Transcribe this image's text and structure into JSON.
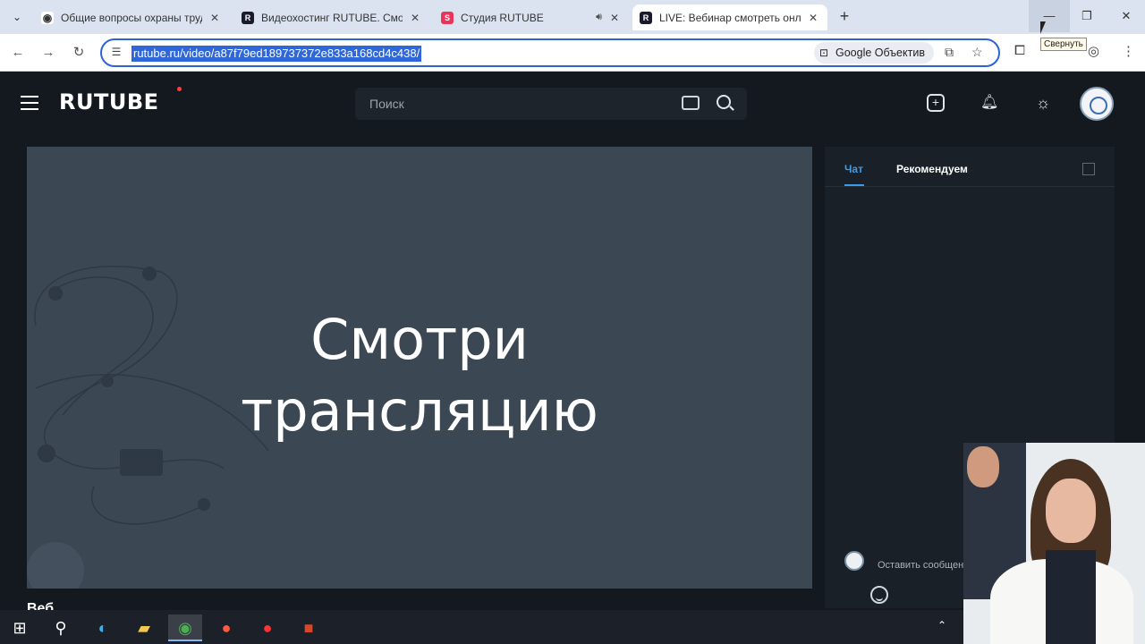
{
  "browser": {
    "tabs": [
      {
        "title": "Общие вопросы охраны труда",
        "favicon": "eye-icon",
        "color": "#3a3a3a"
      },
      {
        "title": "Видеохостинг RUTUBE. Смотри",
        "favicon": "R",
        "color": "#1a1a2e"
      },
      {
        "title": "Студия RUTUBE",
        "favicon": "S",
        "color": "#e9355b"
      },
      {
        "title": "LIVE: Вебинар смотреть онлайн",
        "favicon": "R",
        "color": "#1a1a2e"
      }
    ],
    "url": "rutube.ru/video/a87f79ed189737372e833a168cd4c438/",
    "lens_label": "Google Объектив",
    "tooltip": "Свернуть"
  },
  "rutube": {
    "logo": "RUTUBE",
    "search_placeholder": "Поиск",
    "player_title_line1": "Смотри",
    "player_title_line2": "трансляцию",
    "sidebar_tabs": [
      "Чат",
      "Рекомендуем"
    ],
    "chat_input_placeholder": "Оставить сообщен",
    "below_title": "Веб"
  },
  "colors": {
    "accent": "#3b9bea",
    "player_bg": "#3c4754",
    "page_bg": "#14191f"
  },
  "taskbar": {
    "items": [
      "windows-start-icon",
      "search-icon",
      "edge-icon",
      "file-explorer-icon",
      "chrome-icon",
      "yandex-browser-icon",
      "yandex-icon",
      "powerpoint-icon"
    ]
  }
}
